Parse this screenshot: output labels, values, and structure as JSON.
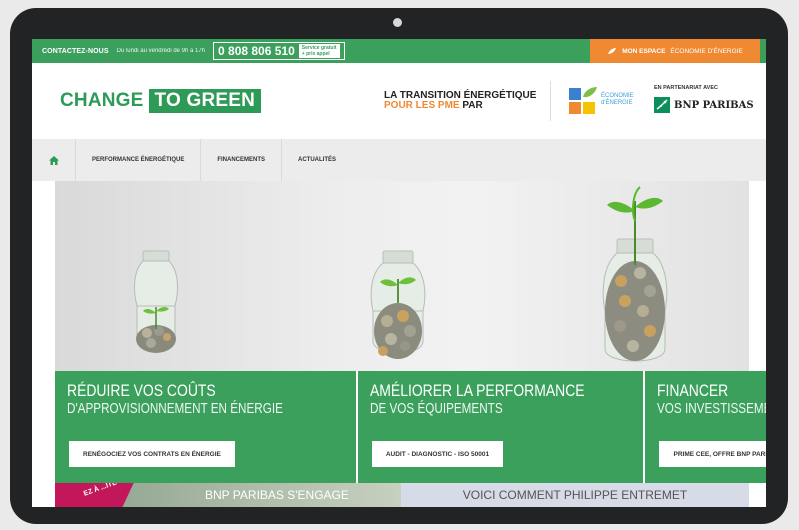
{
  "topbar": {
    "contact_label": "CONTACTEZ-NOUS",
    "hours": "Du lundi au vendredi de 9h à 17h",
    "phone": "0 808 806 510",
    "phone_tag_line1": "Service gratuit",
    "phone_tag_line2": "+ prix appel",
    "my_space_bold": "MON ESPACE",
    "my_space_light": "ÉCONOMIE D'ÉNERGIE",
    "color": "#3aa05c",
    "accent": "#f08a32"
  },
  "header": {
    "logo_part1": "CHANGE",
    "logo_part2": "TO GREEN",
    "tagline_line1": "LA TRANSITION ÉNERGÉTIQUE",
    "tagline_line2_orange": "POUR LES PME",
    "tagline_line2_dark": "PAR",
    "eco_line1": "ÉCONOMIE",
    "eco_line2": "d'ÉNERGIE",
    "partner_label": "EN PARTENARIAT AVEC",
    "bnp_label": "BNP PARIBAS"
  },
  "nav": {
    "home_icon": "home-icon",
    "items": [
      "PERFORMANCE ÉNERGÉTIQUE",
      "FINANCEMENTS",
      "ACTUALITÉS"
    ]
  },
  "cards": [
    {
      "title": "RÉDUIRE VOS COÛTS",
      "subtitle": "D'APPROVISIONNEMENT EN ÉNERGIE",
      "button": "RENÉGOCIEZ VOS CONTRATS EN ÉNERGIE"
    },
    {
      "title": "AMÉLIORER LA PERFORMANCE",
      "subtitle": "DE VOS ÉQUIPEMENTS",
      "button": "AUDIT - DIAGNOSTIC - ISO 50001"
    },
    {
      "title": "FINANCER",
      "subtitle": "VOS INVESTISSEMENTS",
      "button": "PRIME CEE, OFFRE BNP PARIBAS"
    }
  ],
  "strip": {
    "left_text": "BNP PARIBAS S'ENGAGE",
    "ribbon_text": "EZ À ...ITÉ",
    "right_text": "VOICI COMMENT PHILIPPE ENTREMET"
  }
}
